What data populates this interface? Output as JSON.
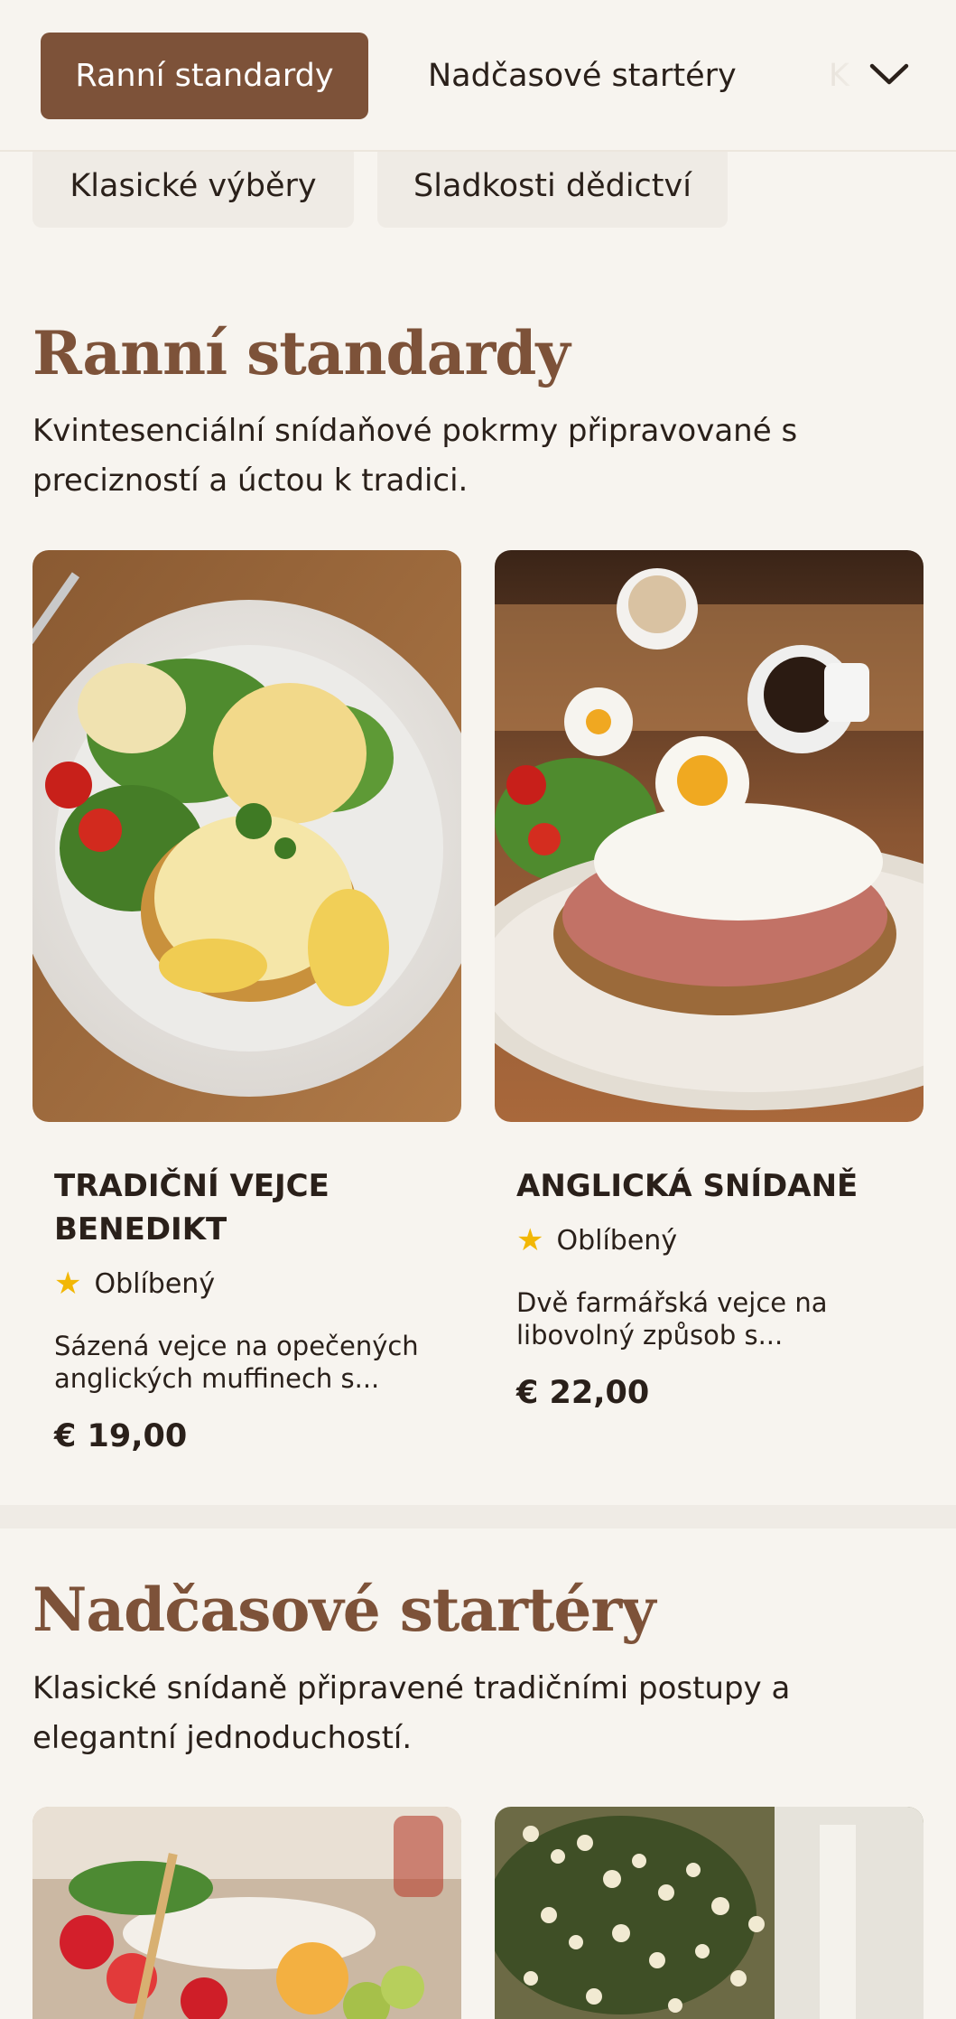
{
  "nav": {
    "tabs": [
      {
        "label": "Ranní standardy",
        "active": true
      },
      {
        "label": "Nadčasové startéry",
        "active": false
      },
      {
        "label": "K",
        "active": false
      }
    ],
    "chips": [
      {
        "label": "Klasické výběry"
      },
      {
        "label": "Sladkosti dědictví"
      }
    ]
  },
  "sections": [
    {
      "title": "Ranní standardy",
      "description": "Kvintesenciální snídaňové pokrmy připravované s precizností a úctou k tradici.",
      "items": [
        {
          "name": "TRADIČNÍ VEJCE BENEDIKT",
          "badge": "Oblíbený",
          "description": "Sázená vejce na opečených anglických muffinech s...",
          "price": "€ 19,00"
        },
        {
          "name": "ANGLICKÁ SNÍDANĚ",
          "badge": "Oblíbený",
          "description": "Dvě farmářská vejce na libovolný způsob s...",
          "price": "€ 22,00"
        }
      ]
    },
    {
      "title": "Nadčasové startéry",
      "description": "Klasické snídaně připravené tradičními postupy a elegantní jednoduchostí."
    }
  ],
  "colors": {
    "accent": "#7d5239",
    "background": "#f7f4ef",
    "star": "#f2b705"
  },
  "icons": {
    "dropdown": "chevron-down-icon",
    "badge": "star-icon"
  }
}
